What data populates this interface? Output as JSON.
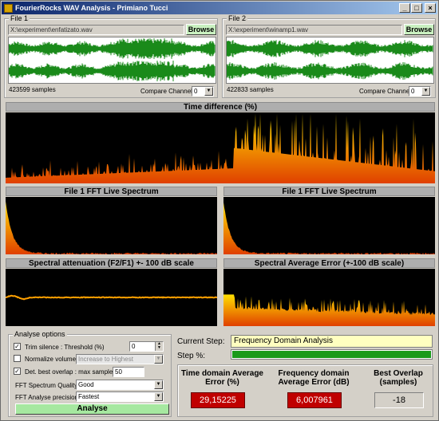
{
  "window": {
    "title": "FourierRocks WAV Analysis - Primiano Tucci"
  },
  "file1": {
    "group_label": "File 1",
    "path": "X:\\experiment\\enfatizato.wav",
    "browse_label": "Browse",
    "samples": "423599 samples",
    "compare_label": "Compare Channel",
    "channel": "0"
  },
  "file2": {
    "group_label": "File 2",
    "path": "X:\\experiment\\winamp1.wav",
    "browse_label": "Browse",
    "samples": "422833 samples",
    "compare_label": "Compare Channel",
    "channel": "0"
  },
  "panels": {
    "time_diff": "Time difference (%)",
    "fft1": "File 1 FFT Live Spectrum",
    "fft2": "File 1 FFT Live Spectrum",
    "atten": "Spectral attenuation (F2/F1) +- 100 dB scale",
    "avgerr": "Spectral Average Error (+-100 dB scale)"
  },
  "options": {
    "group_label": "Analyse options",
    "trim_label": "Trim silence : Threshold (%)",
    "trim_checked": true,
    "trim_value": "0",
    "normalize_label": "Normalize volume",
    "normalize_checked": false,
    "normalize_value": "Increase to Highest",
    "overlap_label": "Det. best overlap : max samples",
    "overlap_checked": true,
    "overlap_value": "50",
    "quality_label": "FFT Spectrum Quality",
    "quality_value": "Good",
    "precision_label": "FFT Analyse precision",
    "precision_value": "Fastest",
    "analyse_label": "Analyse"
  },
  "status": {
    "current_step_label": "Current Step:",
    "current_step_value": "Frequency Domain Analysis",
    "step_pct_label": "Step %:",
    "step_pct": 1.0
  },
  "results": {
    "time_label": "Time domain Average Error (%)",
    "time_value": "29,15225",
    "freq_label": "Frequency domain Average Error (dB)",
    "freq_value": "6,007961",
    "overlap_label": "Best Overlap (samples)",
    "overlap_value": "-18"
  },
  "colors": {
    "wave": "#1a8a1a",
    "plot_bg": "#000000",
    "fire_top": "#ffe000",
    "fire_bottom": "#e04000",
    "progress": "#1a9a1a",
    "result_red": "#c00000"
  }
}
